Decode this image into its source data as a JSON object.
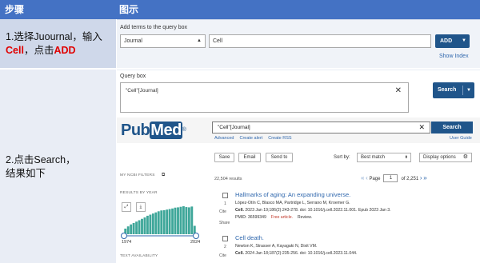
{
  "header": {
    "col1": "步骤",
    "col2": "图示"
  },
  "steps": {
    "step1": {
      "part_a": "1.选择Juournal，输入",
      "part_b": "Cell",
      "part_c": "，点击",
      "part_d": "ADD"
    },
    "step2": {
      "line1": "2.点击Search，",
      "line2": "结果如下"
    }
  },
  "panel1": {
    "label": "Add terms to the query box",
    "field_select": "Journal",
    "term_value": "Cell",
    "add_label": "ADD",
    "show_index": "Show Index"
  },
  "panel2": {
    "query_label": "Query box",
    "query_value": "\"Cell\"[Journal]",
    "search_label": "Search",
    "logo_pub": "Pub",
    "logo_med": "Med",
    "pubmed_query": "\"Cell\"[Journal]",
    "pubmed_search": "Search",
    "links": [
      "Advanced",
      "Create alert",
      "Create RSS"
    ],
    "user_guide": "User Guide",
    "toolbar": {
      "save": "Save",
      "email": "Email",
      "send_to": "Send to",
      "sort_by": "Sort by:",
      "sort_value": "Best match",
      "display": "Display options"
    },
    "sidebar": {
      "filters": "MY NCBI FILTERS",
      "by_year": "RESULTS BY YEAR",
      "availability": "TEXT AVAILABILITY",
      "year_start": "1974",
      "year_end": "2024"
    },
    "results_count": "22,504 results",
    "pager": {
      "page_label": "Page",
      "page_value": "1",
      "of_label": "of 2,251"
    },
    "results": [
      {
        "num": "1",
        "title": "Hallmarks of aging: An expanding universe.",
        "authors": "López-Otín C, Blasco MA, Partridge L, Serrano M, Kroemer G.",
        "journal": "Cell.",
        "citation": " 2023 Jan 19;186(2):243-278. doi: 10.1016/j.cell.2022.11.001. Epub 2023 Jan 3.",
        "pmid": "PMID: 36599349",
        "free": "Free article.",
        "type": "Review.",
        "cite": "Cite",
        "share": "Share"
      },
      {
        "num": "2",
        "title": "Cell death.",
        "authors": "Newton K, Strasser A, Kayagaki N, Dixit VM.",
        "journal": "Cell.",
        "citation": " 2024 Jan 18;187(2):235-256. doi: 10.1016/j.cell.2023.11.044.",
        "cite": "Cite"
      }
    ]
  },
  "chart_data": {
    "type": "bar",
    "x": [
      1974,
      1976,
      1978,
      1980,
      1982,
      1984,
      1986,
      1988,
      1990,
      1992,
      1994,
      1996,
      1998,
      2000,
      2002,
      2004,
      2006,
      2008,
      2010,
      2012,
      2014,
      2016,
      2018,
      2020,
      2022,
      2024
    ],
    "values": [
      20,
      28,
      35,
      40,
      45,
      50,
      55,
      60,
      66,
      70,
      74,
      78,
      82,
      85,
      86,
      88,
      90,
      92,
      95,
      96,
      98,
      100,
      97,
      96,
      99,
      30
    ],
    "ylim": [
      0,
      100
    ],
    "title": "",
    "xlabel": "",
    "ylabel": ""
  }
}
